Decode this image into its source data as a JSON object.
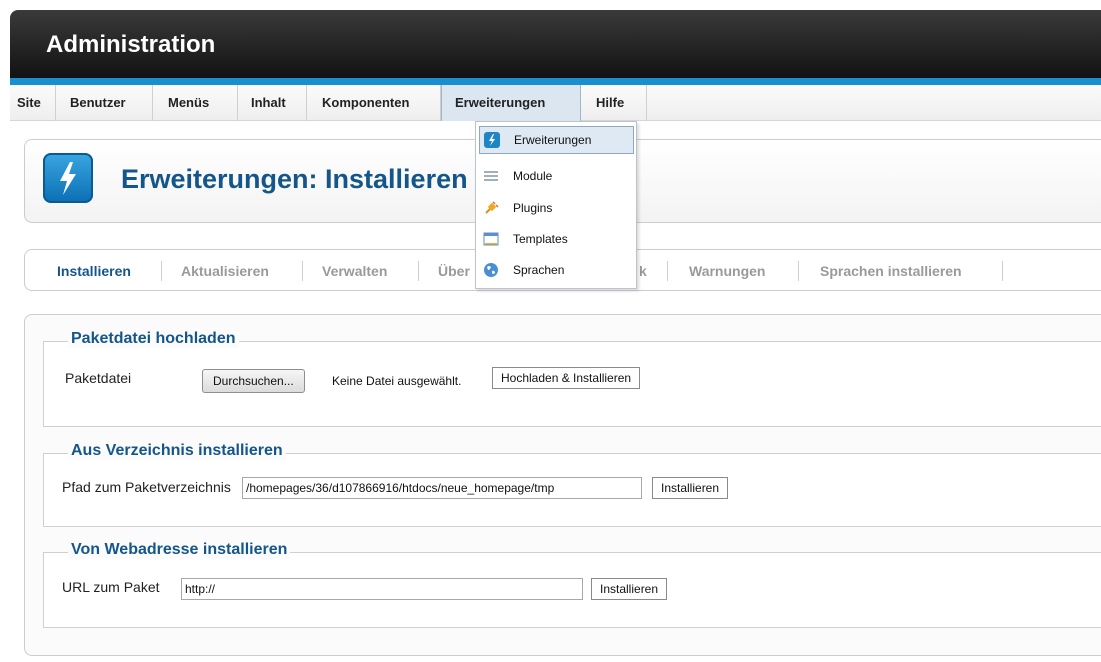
{
  "header": {
    "title": "Administration"
  },
  "menubar": {
    "items": [
      {
        "label": "Site"
      },
      {
        "label": "Benutzer"
      },
      {
        "label": "Menüs"
      },
      {
        "label": "Inhalt"
      },
      {
        "label": "Komponenten"
      },
      {
        "label": "Erweiterungen"
      },
      {
        "label": "Hilfe"
      }
    ],
    "active_index": 5
  },
  "dropdown": {
    "items": [
      {
        "label": "Erweiterungen",
        "icon": "lightning-icon"
      },
      {
        "label": "Module",
        "icon": "module-lines-icon"
      },
      {
        "label": "Plugins",
        "icon": "plug-icon"
      },
      {
        "label": "Templates",
        "icon": "template-window-icon"
      },
      {
        "label": "Sprachen",
        "icon": "globe-icon"
      }
    ],
    "highlighted_index": 0
  },
  "page": {
    "title": "Erweiterungen: Installieren"
  },
  "tabs": {
    "items": [
      {
        "label": "Installieren"
      },
      {
        "label": "Aktualisieren"
      },
      {
        "label": "Verwalten"
      },
      {
        "label": "Über"
      },
      {
        "label": "k"
      },
      {
        "label": "Warnungen"
      },
      {
        "label": "Sprachen installieren"
      }
    ],
    "active_index": 0
  },
  "upload": {
    "legend": "Paketdatei hochladen",
    "label": "Paketdatei",
    "browse_label": "Durchsuchen...",
    "file_status": "Keine Datei ausgewählt.",
    "submit_label": "Hochladen & Installieren"
  },
  "directory": {
    "legend": "Aus Verzeichnis installieren",
    "label": "Pfad zum Paketverzeichnis",
    "value": "/homepages/36/d107866916/htdocs/neue_homepage/tmp",
    "submit_label": "Installieren"
  },
  "url": {
    "legend": "Von Webadresse installieren",
    "label": "URL zum Paket",
    "value": "http://",
    "submit_label": "Installieren"
  },
  "colors": {
    "accent_blue": "#14568a",
    "header_stripe": "#1a8fd0",
    "header_bg": "#111111"
  }
}
